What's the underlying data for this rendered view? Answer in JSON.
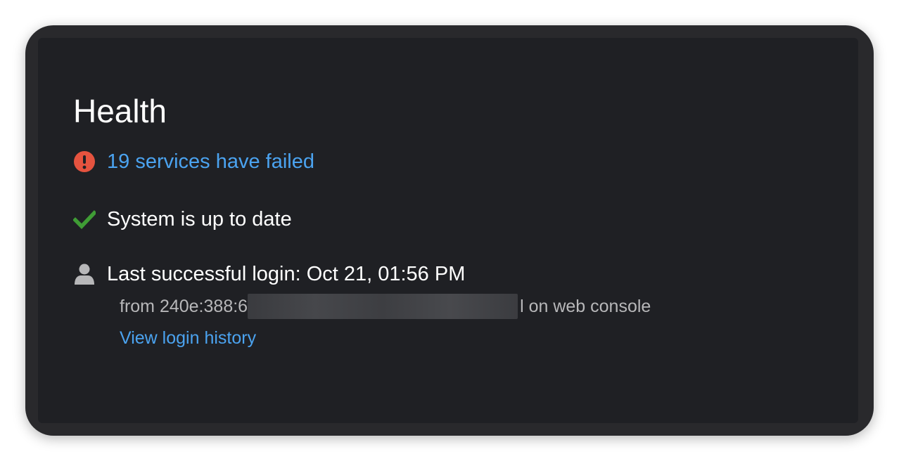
{
  "card": {
    "title": "Health"
  },
  "failed_services": {
    "label": "19 services have failed",
    "icon": "exclamation-circle-icon",
    "color": "#e5533f"
  },
  "system_updates": {
    "label": "System is up to date",
    "icon": "checkmark-icon",
    "color": "#3f9c35"
  },
  "last_login": {
    "label": "Last successful login: Oct 21, 01:56 PM",
    "icon": "user-icon",
    "from_prefix": "from 240e:388:6",
    "from_suffix": "l on web console",
    "history_link": "View login history"
  },
  "colors": {
    "link": "#4ba3f0",
    "card_background": "#1f2024",
    "text": "#ffffff",
    "secondary_text": "#b7b7b9"
  }
}
